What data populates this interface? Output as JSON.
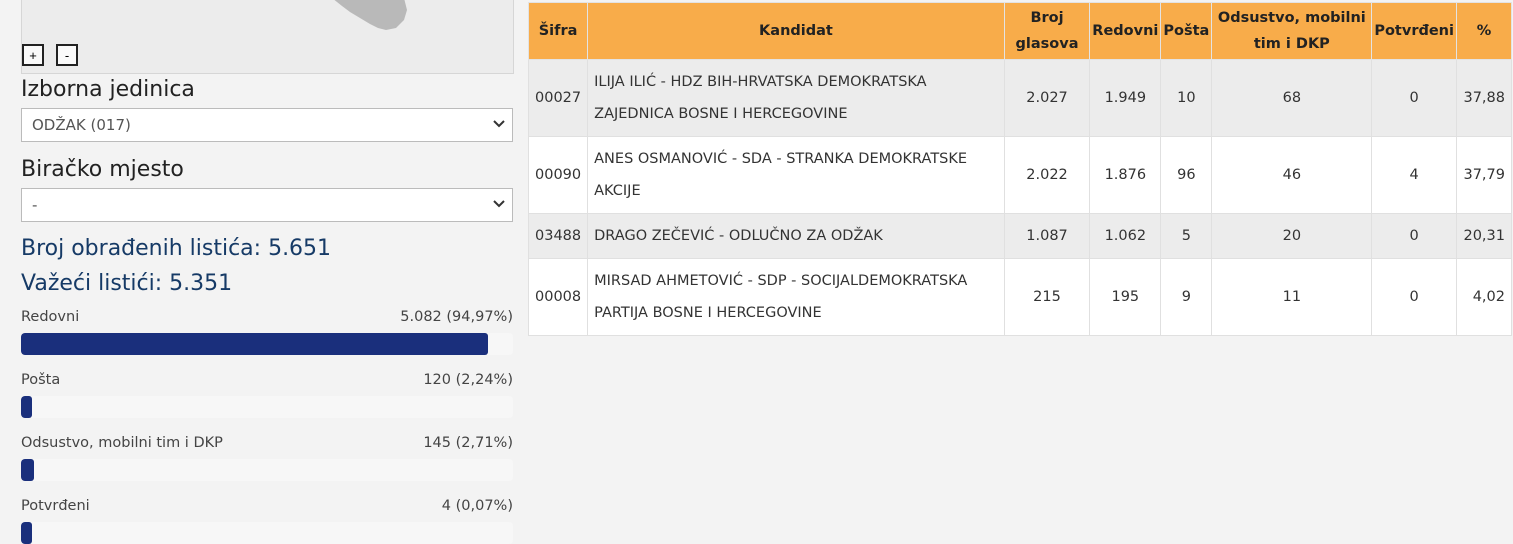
{
  "map": {
    "zoom_in_label": "+",
    "zoom_out_label": "-"
  },
  "filters": {
    "constituency_label": "Izborna jedinica",
    "constituency_value": "ODŽAK (017)",
    "polling_station_label": "Biračko mjesto",
    "polling_station_value": "-"
  },
  "stats": {
    "processed_ballots": "Broj obrađenih listića: 5.651",
    "valid_ballots": "Važeći listići: 5.351"
  },
  "bars": [
    {
      "label": "Redovni",
      "value": "5.082 (94,97%)",
      "fraction": 0.9497
    },
    {
      "label": "Pošta",
      "value": "120 (2,24%)",
      "fraction": 0.0224
    },
    {
      "label": "Odsustvo, mobilni tim i DKP",
      "value": "145 (2,71%)",
      "fraction": 0.0271
    },
    {
      "label": "Potvrđeni",
      "value": "4 (0,07%)",
      "fraction": 0.0007
    }
  ],
  "colors": {
    "header_bg": "#f8ac4a",
    "bar_fill": "#1a2f7c",
    "stat_text": "#163a66"
  },
  "table": {
    "headers": [
      "Šifra",
      "Kandidat",
      "Broj glasova",
      "Redovni",
      "Pošta",
      "Odsustvo, mobilni tim i DKP",
      "Potvrđeni",
      "%"
    ],
    "rows": [
      {
        "code": "00027",
        "candidate": "ILIJA ILIĆ - HDZ BIH-HRVATSKA DEMOKRATSKA ZAJEDNICA BOSNE I HERCEGOVINE",
        "votes": "2.027",
        "regular": "1.949",
        "mail": "10",
        "absent": "68",
        "confirmed": "0",
        "pct": "37,88"
      },
      {
        "code": "00090",
        "candidate": "ANES OSMANOVIĆ - SDA - STRANKA DEMOKRATSKE AKCIJE",
        "votes": "2.022",
        "regular": "1.876",
        "mail": "96",
        "absent": "46",
        "confirmed": "4",
        "pct": "37,79"
      },
      {
        "code": "03488",
        "candidate": "DRAGO ZEČEVIĆ - ODLUČNO ZA ODŽAK",
        "votes": "1.087",
        "regular": "1.062",
        "mail": "5",
        "absent": "20",
        "confirmed": "0",
        "pct": "20,31"
      },
      {
        "code": "00008",
        "candidate": "MIRSAD AHMETOVIĆ - SDP - SOCIJALDEMOKRATSKA PARTIJA BOSNE I HERCEGOVINE",
        "votes": "215",
        "regular": "195",
        "mail": "9",
        "absent": "11",
        "confirmed": "0",
        "pct": "4,02"
      }
    ]
  }
}
